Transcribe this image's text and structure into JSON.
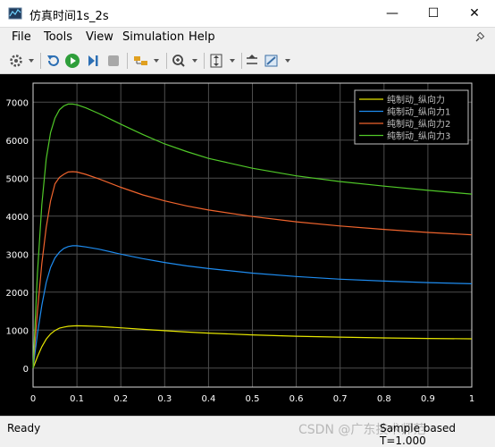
{
  "window": {
    "title": "仿真时间1s_2s",
    "minimize_glyph": "—",
    "maximize_glyph": "☐",
    "close_glyph": "✕"
  },
  "menu": [
    "File",
    "Tools",
    "View",
    "Simulation",
    "Help"
  ],
  "toolbar": {
    "icons": [
      "gear-icon",
      "restore-icon",
      "run-icon",
      "step-forward-icon",
      "stop-icon",
      "highlight-icon",
      "zoom-icon",
      "autoscale-icon",
      "cursor-icon",
      "legend-edit-icon"
    ]
  },
  "status": {
    "left": "Ready",
    "right": "Sample based  T=1.000",
    "watermark": "CSDN @广东技术师范"
  },
  "colors": {
    "background": "#000000",
    "grid": "#4d4d4d",
    "axis_text": "#ffffff",
    "series": [
      "#e6e600",
      "#1e8cf0",
      "#f0642d",
      "#50c828"
    ]
  },
  "chart_data": {
    "type": "line",
    "title": "",
    "xlabel": "",
    "ylabel": "",
    "xlim": [
      0,
      1
    ],
    "ylim": [
      -500,
      7500
    ],
    "xticks": [
      "0",
      "0.1",
      "0.2",
      "0.3",
      "0.4",
      "0.5",
      "0.6",
      "0.7",
      "0.8",
      "0.9",
      "1"
    ],
    "yticks": [
      "0",
      "1000",
      "2000",
      "3000",
      "4000",
      "5000",
      "6000",
      "7000"
    ],
    "grid": true,
    "legend_position": "top-right",
    "x": [
      0,
      0.01,
      0.02,
      0.03,
      0.04,
      0.05,
      0.06,
      0.07,
      0.08,
      0.09,
      0.1,
      0.12,
      0.15,
      0.2,
      0.25,
      0.3,
      0.35,
      0.4,
      0.5,
      0.6,
      0.7,
      0.8,
      0.9,
      1.0
    ],
    "series": [
      {
        "name": "纯制动_纵向力",
        "values": [
          0,
          300,
          560,
          760,
          900,
          990,
          1050,
          1080,
          1100,
          1110,
          1115,
          1110,
          1095,
          1060,
          1020,
          985,
          950,
          920,
          875,
          840,
          815,
          795,
          780,
          770
        ]
      },
      {
        "name": "纯制动_纵向力1",
        "values": [
          0,
          900,
          1650,
          2250,
          2650,
          2900,
          3050,
          3150,
          3200,
          3220,
          3220,
          3190,
          3130,
          3000,
          2880,
          2780,
          2690,
          2620,
          2500,
          2410,
          2340,
          2290,
          2250,
          2220
        ]
      },
      {
        "name": "纯制动_纵向力2",
        "values": [
          0,
          1500,
          2750,
          3700,
          4400,
          4850,
          5020,
          5100,
          5160,
          5170,
          5160,
          5100,
          4980,
          4760,
          4560,
          4400,
          4270,
          4160,
          3990,
          3850,
          3740,
          3650,
          3570,
          3510
        ]
      },
      {
        "name": "纯制动_纵向力3",
        "values": [
          0,
          2500,
          4300,
          5500,
          6200,
          6580,
          6800,
          6900,
          6950,
          6950,
          6930,
          6850,
          6700,
          6420,
          6150,
          5900,
          5700,
          5520,
          5260,
          5060,
          4910,
          4790,
          4680,
          4580
        ]
      }
    ]
  }
}
